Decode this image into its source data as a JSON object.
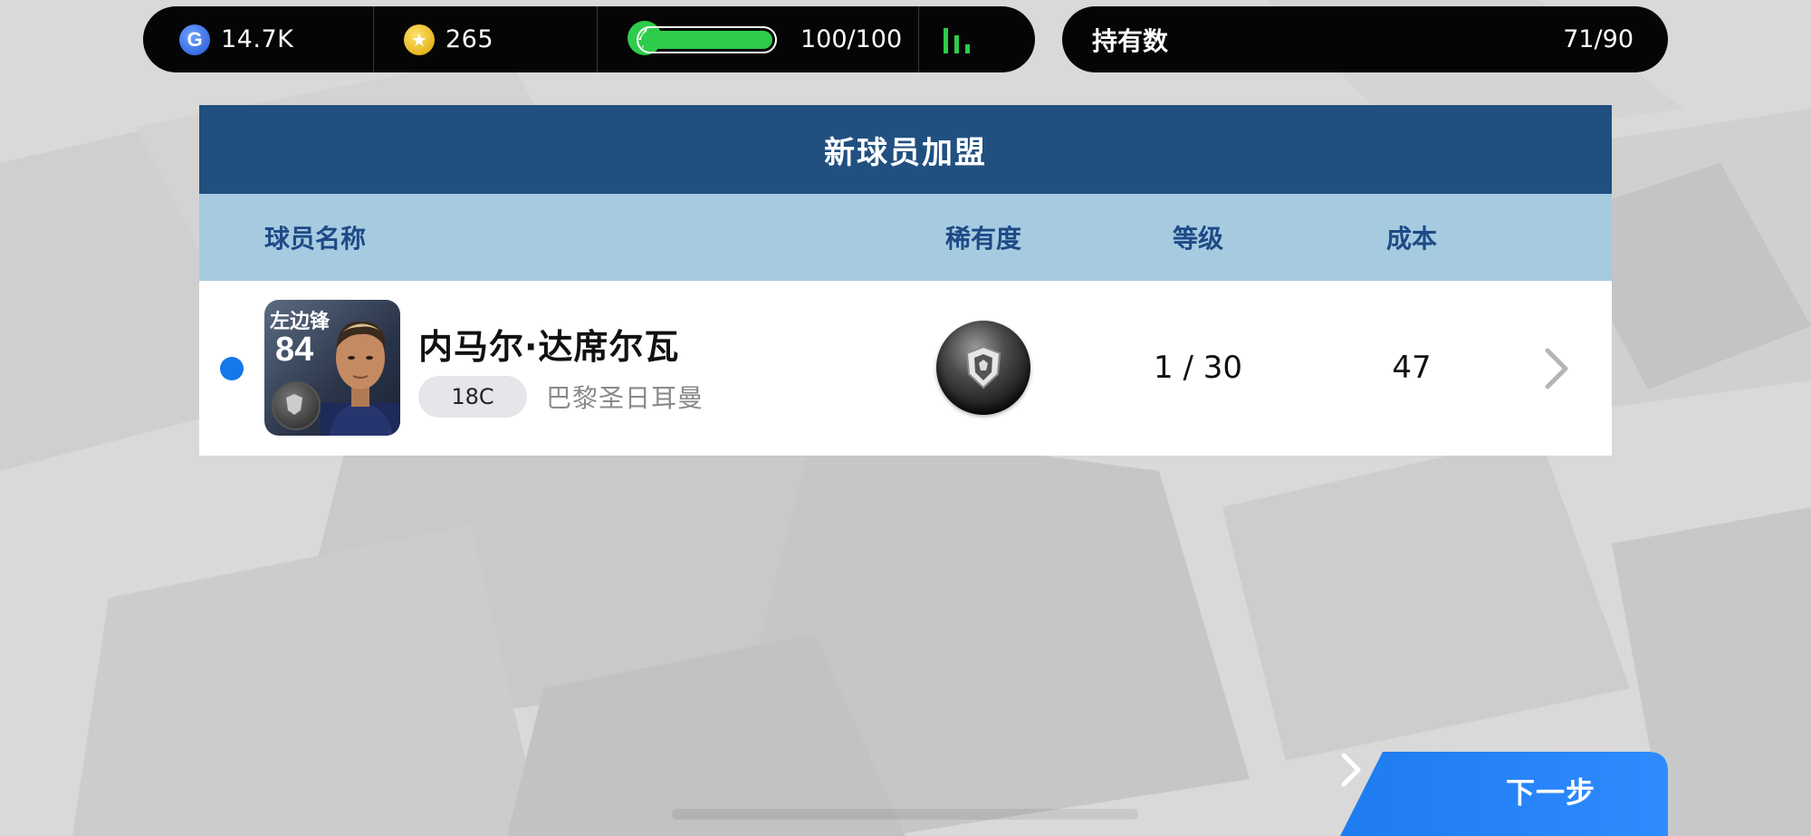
{
  "topbar": {
    "gp": "14.7K",
    "coins": "265",
    "energy_text": "100/100",
    "energy_fill": 1.0,
    "owned_label": "持有数",
    "owned_value": "71/90"
  },
  "panel": {
    "title": "新球员加盟",
    "columns": {
      "name": "球员名称",
      "rarity": "稀有度",
      "level": "等级",
      "cost": "成本"
    },
    "player": {
      "position": "左边锋",
      "rating": "84",
      "name": "内马尔·达席尔瓦",
      "tag": "18C",
      "team": "巴黎圣日耳曼",
      "level": "1 / 30",
      "cost": "47"
    }
  },
  "next_button": {
    "label": "下一步"
  },
  "colors": {
    "title_bar": "#215080",
    "header_bar": "#a6cbe1",
    "accent_blue": "#1578ea",
    "energy_green": "#2ecc4a"
  }
}
